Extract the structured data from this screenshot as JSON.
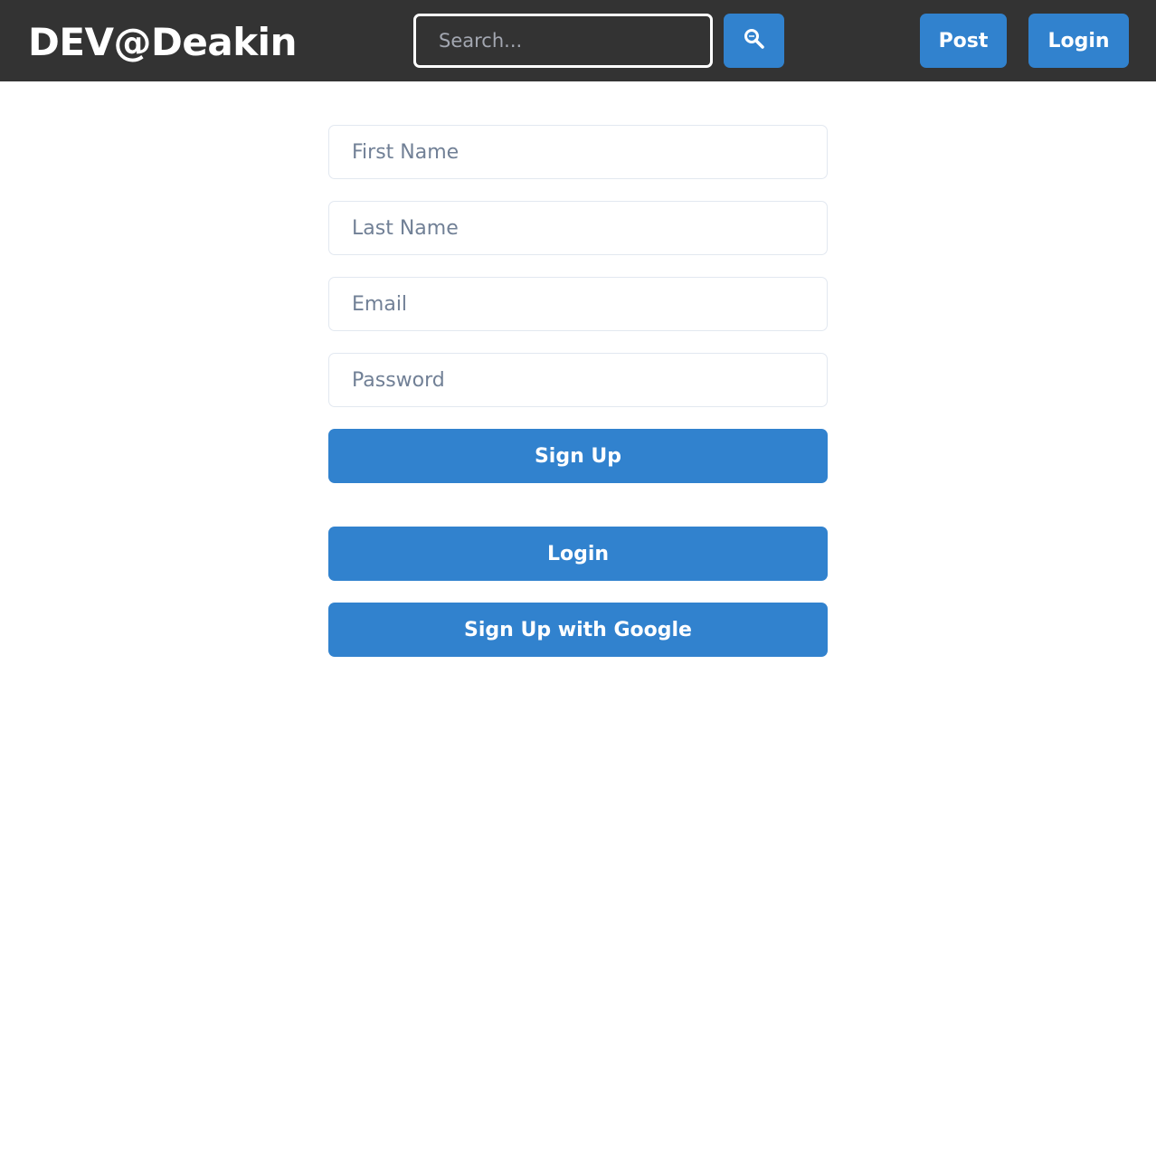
{
  "header": {
    "brand": "DEV@Deakin",
    "search": {
      "placeholder": "Search...",
      "value": ""
    },
    "search_button_icon": "magnifier-icon",
    "post_label": "Post",
    "login_label": "Login"
  },
  "form": {
    "first_name": {
      "placeholder": "First Name",
      "value": ""
    },
    "last_name": {
      "placeholder": "Last Name",
      "value": ""
    },
    "email": {
      "placeholder": "Email",
      "value": ""
    },
    "password": {
      "placeholder": "Password",
      "value": ""
    },
    "signup_label": "Sign Up",
    "login_label": "Login",
    "google_label": "Sign Up with Google"
  },
  "colors": {
    "navbar": "#333333",
    "accent": "#3182ce",
    "field_border": "#e2e8f0",
    "placeholder": "#718096"
  }
}
